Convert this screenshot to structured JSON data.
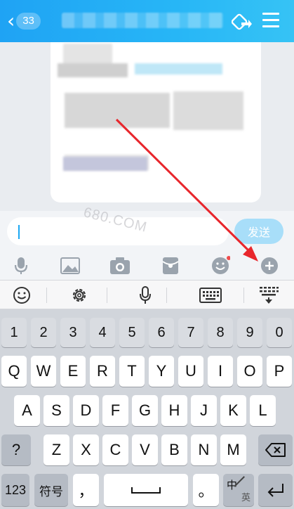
{
  "header": {
    "back_count": "33",
    "back_icon": "chevron-left-icon",
    "share_icon": "share-icon",
    "menu_icon": "menu-icon",
    "gradient": [
      "#1fa3f4",
      "#36c3f5"
    ]
  },
  "input": {
    "value": "",
    "send_label": "发送"
  },
  "watermark": "680.COM",
  "toolbar": {
    "icons": [
      "microphone-icon",
      "image-icon",
      "camera-icon",
      "red-packet-icon",
      "emoji-icon",
      "plus-icon"
    ]
  },
  "keyboard_toolbar": {
    "icons": [
      "emoji-icon",
      "settings-gear-icon",
      "microphone-icon",
      "keyboard-icon",
      "collapse-keyboard-icon"
    ]
  },
  "keyboard": {
    "numbers": [
      "1",
      "2",
      "3",
      "4",
      "5",
      "6",
      "7",
      "8",
      "9",
      "0"
    ],
    "row1": [
      "Q",
      "W",
      "E",
      "R",
      "T",
      "Y",
      "U",
      "I",
      "O",
      "P"
    ],
    "row2": [
      "A",
      "S",
      "D",
      "F",
      "G",
      "H",
      "J",
      "K",
      "L"
    ],
    "row3_left": "?",
    "row3": [
      "Z",
      "X",
      "C",
      "V",
      "B",
      "N",
      "M"
    ],
    "bottom": {
      "num_switch": "123",
      "symbols": "符号",
      "comma": "，",
      "period": "。",
      "lang_top": "中",
      "lang_bottom": "英"
    }
  },
  "colors": {
    "accent": "#1fa3f4",
    "arrow": "#e8262c",
    "send_disabled": "#a8def9"
  }
}
